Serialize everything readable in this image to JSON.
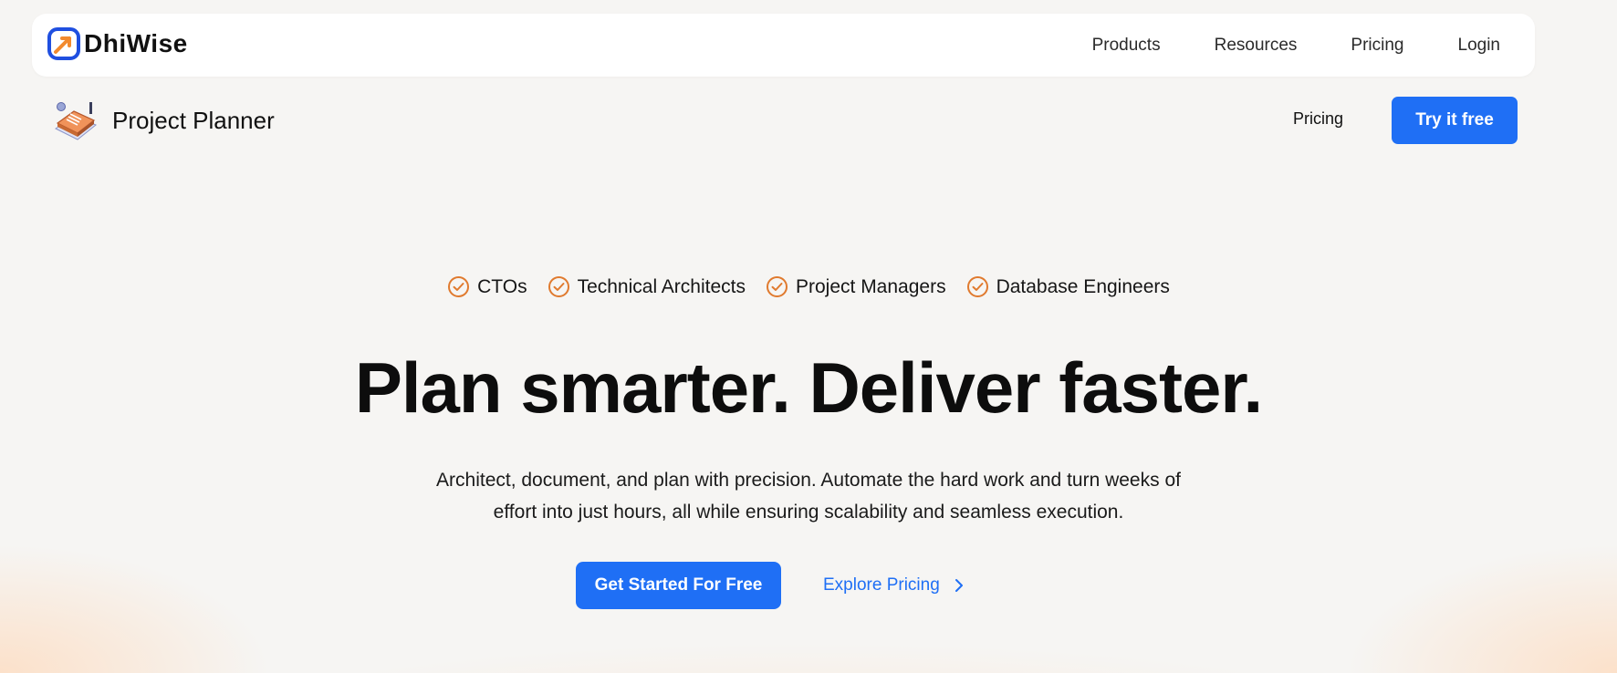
{
  "topnav": {
    "brand": "DhiWise",
    "links": [
      "Products",
      "Resources",
      "Pricing",
      "Login"
    ]
  },
  "subheader": {
    "title": "Project Planner",
    "pricing_label": "Pricing",
    "try_label": "Try it free"
  },
  "audience": [
    "CTOs",
    "Technical Architects",
    "Project Managers",
    "Database Engineers"
  ],
  "hero": {
    "title": "Plan smarter. Deliver faster.",
    "subtitle_line1": "Architect, document, and plan with precision. Automate the hard work and turn weeks of",
    "subtitle_line2": "effort into just hours, all while ensuring scalability and seamless execution.",
    "cta_primary": "Get Started For Free",
    "cta_secondary": "Explore Pricing"
  },
  "colors": {
    "accent": "#1f6ff5",
    "check": "#e07a2e",
    "background": "#f6f5f3"
  },
  "icons": {
    "brand": "dhiwise-logo-icon",
    "product": "project-planner-icon",
    "check": "check-circle-icon",
    "chevron": "chevron-right-icon"
  }
}
